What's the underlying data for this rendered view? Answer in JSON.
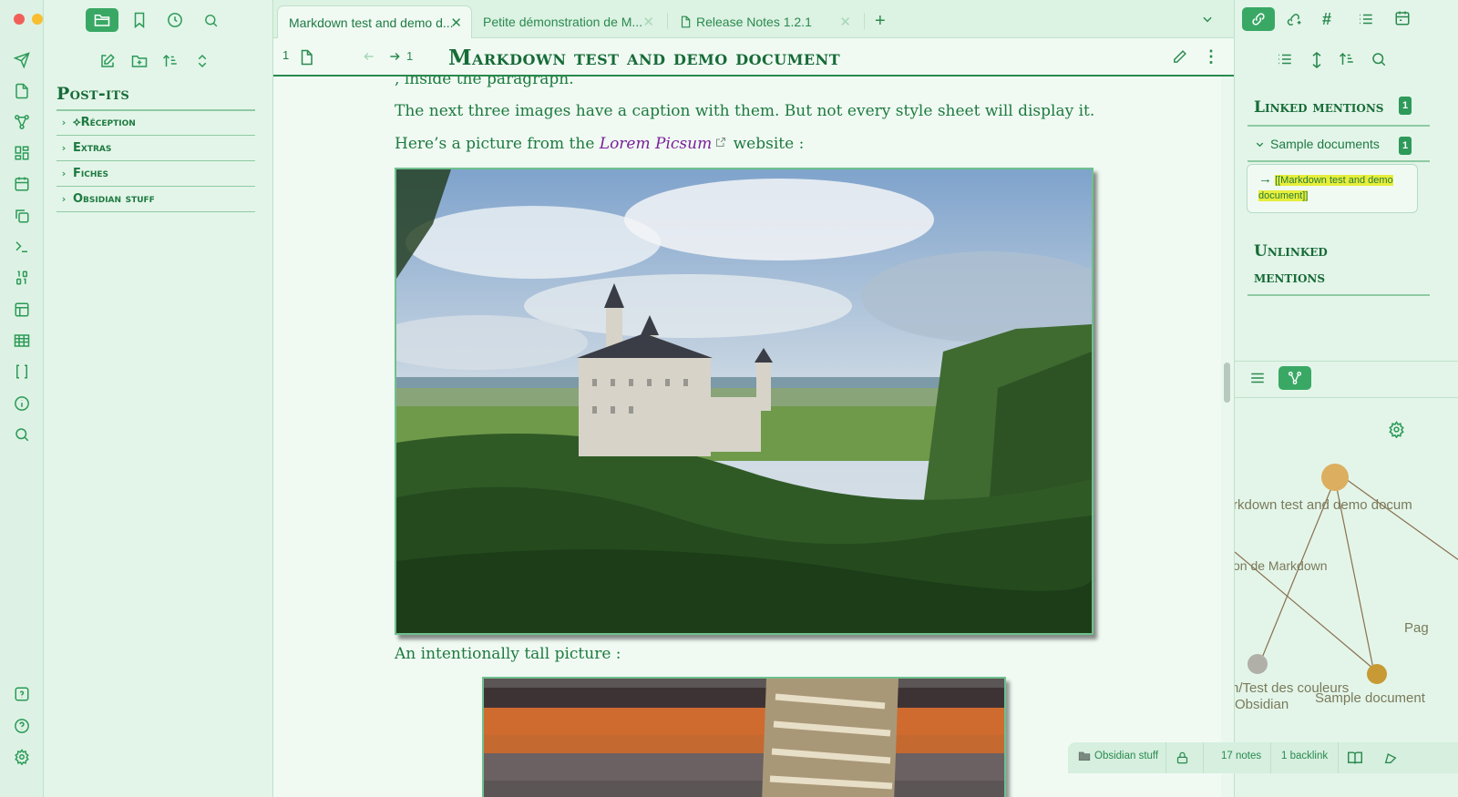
{
  "colors": {
    "accent": "#3aa865",
    "text_green": "#1e7a3f",
    "link_purple": "#7a1f9a",
    "highlight": "#e7ee3a",
    "background": "#f0faf3"
  },
  "left_panel": {
    "title": "Post-its",
    "items": [
      {
        "label": "⟡Réception",
        "icon": "chevron-right-icon"
      },
      {
        "label": "Extras",
        "icon": "chevron-right-icon"
      },
      {
        "label": "Fiches",
        "icon": "chevron-right-icon"
      },
      {
        "label": "Obsidian stuff",
        "icon": "chevron-right-icon"
      }
    ]
  },
  "tabs": [
    {
      "label": "Markdown test and demo d...",
      "active": true
    },
    {
      "label": "Petite démonstration de M...",
      "active": false
    },
    {
      "label": "Release Notes 1.2.1",
      "active": false
    }
  ],
  "view_header": {
    "backlink_count": "1",
    "forward_count": "1",
    "title": "Markdown test and demo document"
  },
  "editor": {
    "cut_line": ", inside the paragraph.",
    "caption_line": "The next three images have a caption with them. But not every style sheet will display it.",
    "picsum_before": "Here’s a picture from the ",
    "picsum_link": "Lorem Picsum",
    "picsum_after": " website :",
    "tall_picture_line": "An intentionally tall picture :"
  },
  "right_panel": {
    "linked_title": "Linked mentions",
    "linked_count": "1",
    "group_label": "Sample documents",
    "group_count": "1",
    "mention_arrow": "→",
    "mention_text_1": "[[Markdown test and demo",
    "mention_text_2": "document]]",
    "unlinked_title_1": "Unlinked",
    "unlinked_title_2": "mentions"
  },
  "graph": {
    "labels": {
      "main": "rkdown test and demo docum",
      "markdown_fr": "on de Markdown",
      "page": "Pag",
      "couleurs_1": "n/Test des couleurs",
      "couleurs_2": "Obsidian",
      "sample": "Sample document"
    },
    "node_colors": [
      "#dcae5f",
      "#b0b0a8",
      "#c79a35"
    ]
  },
  "status_bar": {
    "folder": "Obsidian stuff",
    "notes": "17 notes",
    "backlinks": "1 backlink"
  }
}
